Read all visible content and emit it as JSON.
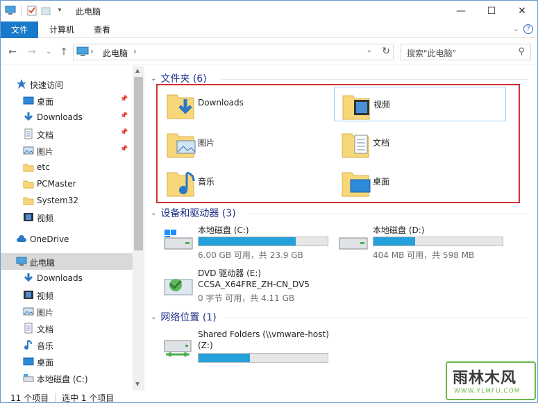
{
  "window": {
    "title": "此电脑",
    "minimize": "—",
    "maximize": "☐",
    "close": "✕"
  },
  "ribbon": {
    "tabs": [
      "文件",
      "计算机",
      "查看"
    ],
    "help": "?",
    "collapse": "⌄"
  },
  "address": {
    "crumb": "此电脑",
    "chev": "›",
    "search_placeholder": "搜索\"此电脑\""
  },
  "nav": {
    "quick_access": "快速访问",
    "quick": [
      {
        "label": "桌面",
        "icon": "desktop-icon",
        "pinned": true
      },
      {
        "label": "Downloads",
        "icon": "download-icon",
        "pinned": true
      },
      {
        "label": "文档",
        "icon": "document-icon",
        "pinned": true
      },
      {
        "label": "图片",
        "icon": "picture-icon",
        "pinned": true
      },
      {
        "label": "etc",
        "icon": "folder-icon",
        "pinned": false
      },
      {
        "label": "PCMaster",
        "icon": "folder-icon",
        "pinned": false
      },
      {
        "label": "System32",
        "icon": "folder-icon",
        "pinned": false
      },
      {
        "label": "视频",
        "icon": "video-icon",
        "pinned": false
      }
    ],
    "onedrive": "OneDrive",
    "thispc": "此电脑",
    "pc": [
      {
        "label": "Downloads",
        "icon": "download-icon"
      },
      {
        "label": "视频",
        "icon": "video-icon"
      },
      {
        "label": "图片",
        "icon": "picture-icon"
      },
      {
        "label": "文档",
        "icon": "document-icon"
      },
      {
        "label": "音乐",
        "icon": "music-icon"
      },
      {
        "label": "桌面",
        "icon": "desktop-icon"
      },
      {
        "label": "本地磁盘 (C:)",
        "icon": "drive-icon"
      }
    ]
  },
  "content": {
    "folders_header": "文件夹 (6)",
    "folders": [
      {
        "name": "Downloads",
        "icon": "download-icon"
      },
      {
        "name": "视频",
        "icon": "video-icon",
        "selected": true
      },
      {
        "name": "图片",
        "icon": "picture-icon"
      },
      {
        "name": "文档",
        "icon": "document-icon"
      },
      {
        "name": "音乐",
        "icon": "music-icon"
      },
      {
        "name": "桌面",
        "icon": "desktop-icon"
      }
    ],
    "devices_header": "设备和驱动器 (3)",
    "drives": [
      {
        "name": "本地磁盘 (C:)",
        "size": "6.00 GB 可用，共 23.9 GB",
        "used_fraction": 0.75,
        "icon": "windows-drive-icon"
      },
      {
        "name": "本地磁盘 (D:)",
        "size": "404 MB 可用，共 598 MB",
        "used_fraction": 0.32,
        "icon": "drive-icon"
      }
    ],
    "dvd": {
      "name": "DVD 驱动器 (E:)",
      "label": "CCSA_X64FRE_ZH-CN_DV5",
      "size": "0 字节 可用，共 4.11 GB"
    },
    "network_header": "网络位置 (1)",
    "network": {
      "name": "Shared Folders (\\\\vmware-host)",
      "name2": "(Z:)",
      "used_fraction": 0.4
    }
  },
  "status": {
    "count": "11 个项目",
    "selected": "选中 1 个项目"
  },
  "watermark": {
    "brand": "雨林木风",
    "url": "WWW.YLMFU.COM"
  },
  "colors": {
    "accent": "#1979ca",
    "header": "#1e3287",
    "bar": "#26a0da",
    "highlight": "#d32f2f"
  }
}
